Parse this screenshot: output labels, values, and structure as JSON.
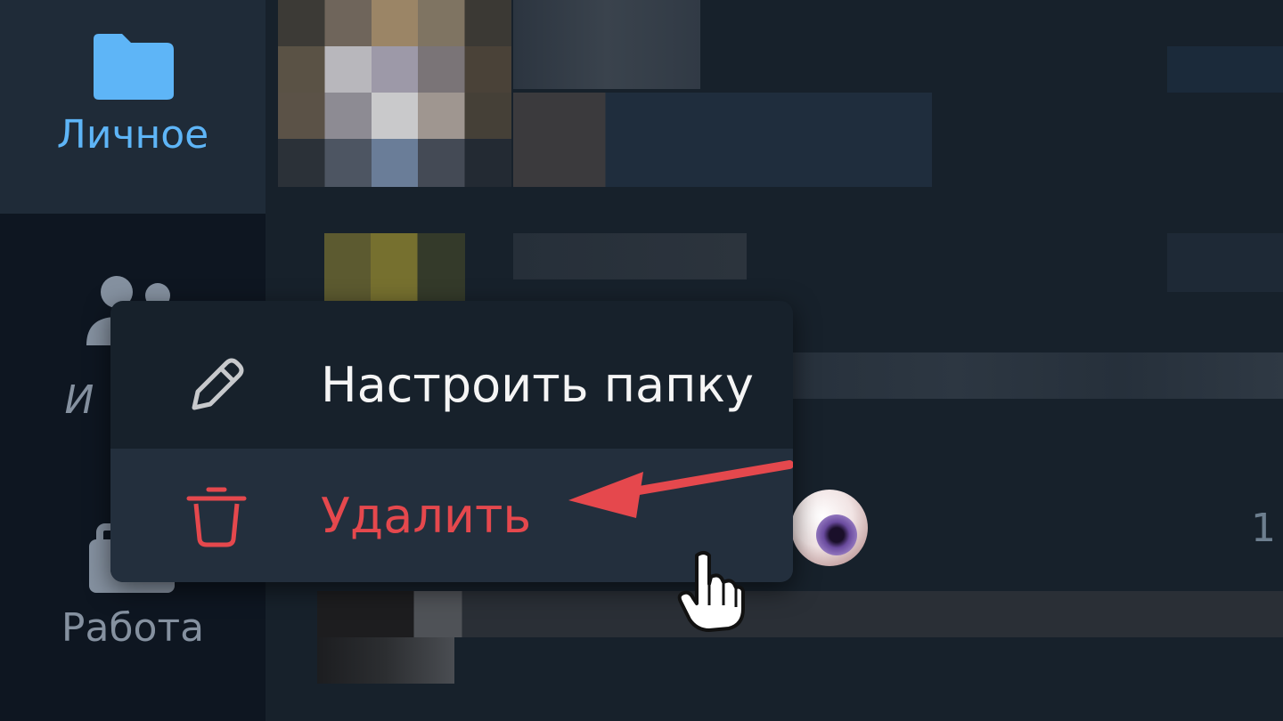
{
  "sidebar": {
    "folders": [
      {
        "label": "Личное",
        "icon": "folder-icon",
        "active": true
      },
      {
        "label": "",
        "icon": "people-icon",
        "active": false
      },
      {
        "label": "Работа",
        "icon": "briefcase-icon",
        "active": false
      }
    ],
    "partial_label": "И"
  },
  "context_menu": {
    "items": [
      {
        "label": "Настроить папку",
        "icon": "pencil-icon"
      },
      {
        "label": "Удалить",
        "icon": "trash-icon",
        "color": "#e5484d"
      }
    ]
  },
  "chat_row": {
    "time_partial": "1"
  },
  "colors": {
    "accent": "#5eb5f7",
    "danger": "#e5484d",
    "sidebar_bg": "#0e1621",
    "menu_bg": "#17212b"
  }
}
